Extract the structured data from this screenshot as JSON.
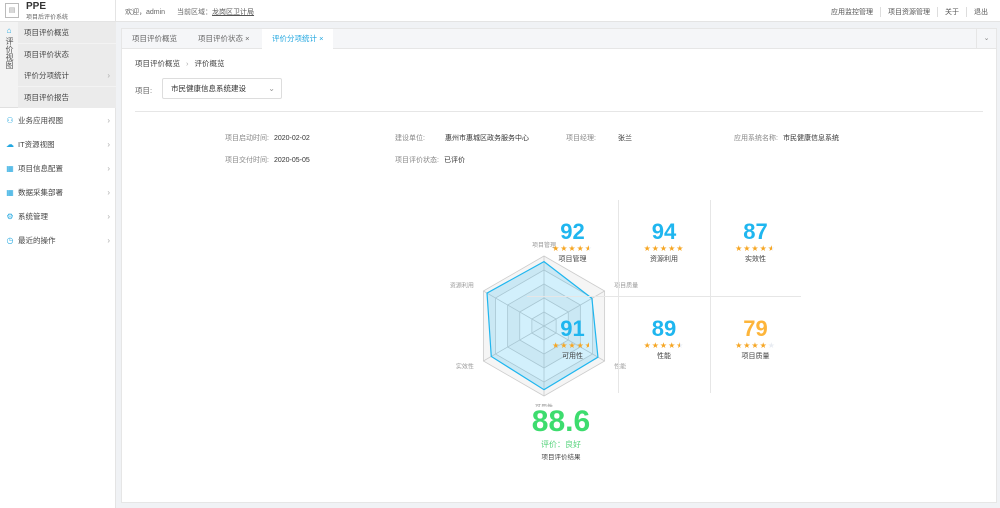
{
  "app": {
    "title": "PPE",
    "subtitle": "项目后评价系统",
    "logo_icon": "document-icon"
  },
  "header": {
    "welcome": "欢迎，admin",
    "region_label": "当前区域：",
    "region": "龙岗区卫计局",
    "nav": [
      "应用监控管理",
      "项目资源管理",
      "关于",
      "退出"
    ]
  },
  "sidebar": {
    "section": {
      "label": "评价视图",
      "icon": "home-icon",
      "items": [
        {
          "label": "项目评价概览"
        },
        {
          "label": "项目评价状态"
        },
        {
          "label": "评价分项统计",
          "has_children": true
        },
        {
          "label": "项目评价报告"
        }
      ]
    },
    "items": [
      {
        "label": "业务应用视图",
        "icon": "user-icon"
      },
      {
        "label": "IT资源视图",
        "icon": "cloud-icon"
      },
      {
        "label": "项目信息配置",
        "icon": "grid-icon"
      },
      {
        "label": "数据采集部署",
        "icon": "grid-icon"
      },
      {
        "label": "系统管理",
        "icon": "gear-icon"
      },
      {
        "label": "最近的操作",
        "icon": "clock-icon"
      }
    ]
  },
  "tabs": [
    {
      "label": "项目评价概览",
      "closable": false
    },
    {
      "label": "项目评价状态",
      "closable": true
    },
    {
      "label": "评价分项统计",
      "closable": true,
      "active": true
    }
  ],
  "breadcrumb": [
    "项目评价概览",
    "评价概览"
  ],
  "project": {
    "label": "项目:",
    "value": "市民健康信息系统建设"
  },
  "info": [
    {
      "k": "项目启动时间:",
      "v": "2020-02-02"
    },
    {
      "k": "建设单位:",
      "v": "惠州市惠城区政务服务中心"
    },
    {
      "k": "项目经理:",
      "v": "张兰"
    },
    {
      "k": "应用系统名称:",
      "v": "市民健康信息系统"
    },
    {
      "k": "项目交付时间:",
      "v": "2020-05-05"
    },
    {
      "k": "项目评价状态:",
      "v": "已评价"
    }
  ],
  "chart_data": {
    "type": "radar",
    "max": 100,
    "indicators": [
      "项目管理",
      "项目质量",
      "性能",
      "可用性",
      "实效性",
      "资源利用"
    ],
    "values": [
      92,
      79,
      89,
      91,
      87,
      94
    ],
    "color": "#1fb6ef"
  },
  "scores": [
    {
      "value": "92",
      "label": "项目管理",
      "stars": 4.5
    },
    {
      "value": "94",
      "label": "资源利用",
      "stars": 5
    },
    {
      "value": "87",
      "label": "实效性",
      "stars": 4.5
    },
    {
      "value": "91",
      "label": "可用性",
      "stars": 4.5
    },
    {
      "value": "89",
      "label": "性能",
      "stars": 4.5
    },
    {
      "value": "79",
      "label": "项目质量",
      "stars": 4,
      "warn": true
    }
  ],
  "total": {
    "value": "88.6",
    "grade": "评价：良好",
    "label": "项目评价结果"
  },
  "colors": {
    "accent": "#1fb6ef",
    "warn": "#fdb53a",
    "good": "#3ddc6e",
    "star": "#f6a623"
  }
}
